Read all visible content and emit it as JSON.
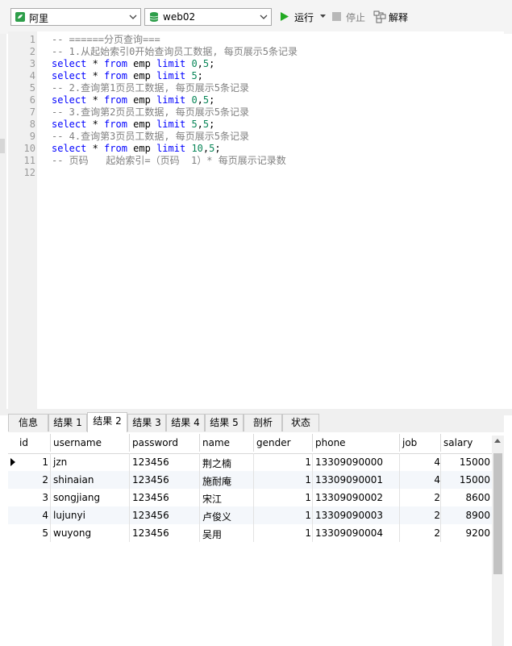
{
  "toolbar": {
    "connection": "阿里",
    "database": "web02",
    "run_label": "运行",
    "stop_label": "停止",
    "explain_label": "解释"
  },
  "editor": {
    "lines": [
      {
        "n": "1",
        "tokens": [
          [
            "cm",
            "-- ======分页查询==="
          ]
        ]
      },
      {
        "n": "2",
        "tokens": [
          [
            "cm",
            "-- 1.从起始索引0开始查询员工数据, 每页展示5条记录"
          ]
        ]
      },
      {
        "n": "3",
        "tokens": [
          [
            "kw",
            "select"
          ],
          [
            "pl",
            " * "
          ],
          [
            "kw",
            "from"
          ],
          [
            "pl",
            " emp "
          ],
          [
            "kw",
            "limit"
          ],
          [
            "pl",
            " "
          ],
          [
            "num",
            "0"
          ],
          [
            "pl",
            ","
          ],
          [
            "num",
            "5"
          ],
          [
            "pl",
            ";"
          ]
        ]
      },
      {
        "n": "4",
        "tokens": [
          [
            "kw",
            "select"
          ],
          [
            "pl",
            " * "
          ],
          [
            "kw",
            "from"
          ],
          [
            "pl",
            " emp "
          ],
          [
            "kw",
            "limit"
          ],
          [
            "pl",
            " "
          ],
          [
            "num",
            "5"
          ],
          [
            "pl",
            ";"
          ]
        ]
      },
      {
        "n": "5",
        "tokens": [
          [
            "cm",
            "-- 2.查询第1页员工数据, 每页展示5条记录"
          ]
        ]
      },
      {
        "n": "6",
        "tokens": [
          [
            "kw",
            "select"
          ],
          [
            "pl",
            " * "
          ],
          [
            "kw",
            "from"
          ],
          [
            "pl",
            " emp "
          ],
          [
            "kw",
            "limit"
          ],
          [
            "pl",
            " "
          ],
          [
            "num",
            "0"
          ],
          [
            "pl",
            ","
          ],
          [
            "num",
            "5"
          ],
          [
            "pl",
            ";"
          ]
        ]
      },
      {
        "n": "7",
        "tokens": [
          [
            "cm",
            "-- 3.查询第2页员工数据, 每页展示5条记录"
          ]
        ]
      },
      {
        "n": "8",
        "tokens": [
          [
            "kw",
            "select"
          ],
          [
            "pl",
            " * "
          ],
          [
            "kw",
            "from"
          ],
          [
            "pl",
            " emp "
          ],
          [
            "kw",
            "limit"
          ],
          [
            "pl",
            " "
          ],
          [
            "num",
            "5"
          ],
          [
            "pl",
            ","
          ],
          [
            "num",
            "5"
          ],
          [
            "pl",
            ";"
          ]
        ]
      },
      {
        "n": "9",
        "tokens": [
          [
            "cm",
            "-- 4.查询第3页员工数据, 每页展示5条记录"
          ]
        ]
      },
      {
        "n": "10",
        "tokens": [
          [
            "kw",
            "select"
          ],
          [
            "pl",
            " * "
          ],
          [
            "kw",
            "from"
          ],
          [
            "pl",
            " emp "
          ],
          [
            "kw",
            "limit"
          ],
          [
            "pl",
            " "
          ],
          [
            "num",
            "10"
          ],
          [
            "pl",
            ","
          ],
          [
            "num",
            "5"
          ],
          [
            "pl",
            ";"
          ]
        ]
      },
      {
        "n": "11",
        "tokens": [
          [
            "cm",
            "-- 页码   起始索引=（页码  1）* 每页展示记录数"
          ]
        ]
      },
      {
        "n": "12",
        "tokens": []
      }
    ]
  },
  "tabs": [
    "信息",
    "结果 1",
    "结果 2",
    "结果 3",
    "结果 4",
    "结果 5",
    "剖析",
    "状态"
  ],
  "active_tab": 2,
  "grid": {
    "columns": [
      "id",
      "username",
      "password",
      "name",
      "gender",
      "phone",
      "job",
      "salary"
    ],
    "rows": [
      [
        "1",
        "jzn",
        "123456",
        "荆之楠",
        "1",
        "13309090000",
        "4",
        "15000"
      ],
      [
        "2",
        "shinaian",
        "123456",
        "施耐庵",
        "1",
        "13309090001",
        "4",
        "15000"
      ],
      [
        "3",
        "songjiang",
        "123456",
        "宋江",
        "1",
        "13309090002",
        "2",
        "8600"
      ],
      [
        "4",
        "lujunyi",
        "123456",
        "卢俊义",
        "1",
        "13309090003",
        "2",
        "8900"
      ],
      [
        "5",
        "wuyong",
        "123456",
        "吴用",
        "1",
        "13309090004",
        "2",
        "9200"
      ]
    ]
  },
  "colors": {
    "keyword": "#0000ff",
    "comment": "#808080",
    "number": "#098658",
    "run_icon": "#22aa22"
  }
}
